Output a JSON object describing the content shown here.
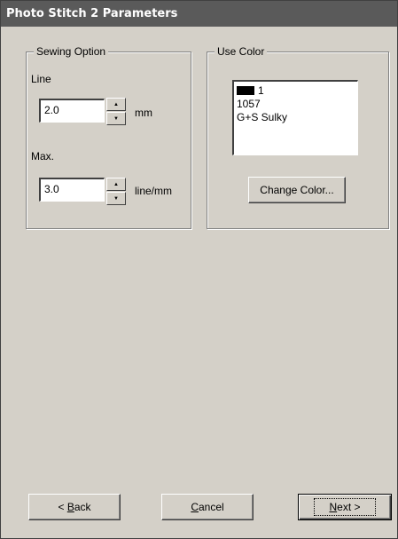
{
  "window": {
    "title": "Photo Stitch 2 Parameters"
  },
  "sewing_option": {
    "legend": "Sewing Option",
    "line_label": "Line",
    "line_value": "2.0",
    "line_unit": "mm",
    "max_label": "Max.",
    "max_value": "3.0",
    "max_unit": "line/mm"
  },
  "use_color": {
    "legend": "Use Color",
    "swatch_color": "#000000",
    "color_number": "1",
    "color_code": "1057",
    "color_brand": "G+S Sulky",
    "change_button": "Change Color..."
  },
  "footer": {
    "back_prefix": "< ",
    "back_mnemonic": "B",
    "back_rest": "ack",
    "cancel_mnemonic": "C",
    "cancel_rest": "ancel",
    "next_mnemonic": "N",
    "next_rest": "ext >"
  }
}
